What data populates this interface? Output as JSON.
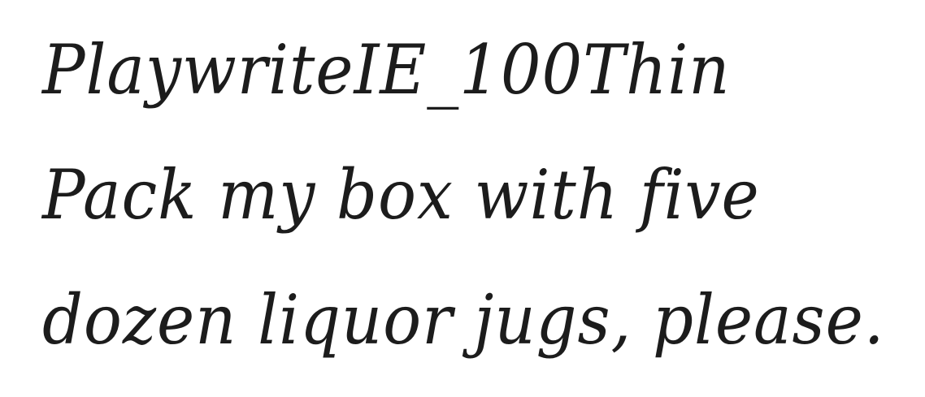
{
  "sample": {
    "font_title": "PlaywriteIE_100Thin",
    "pangram_line_1": "Pack my box with five",
    "pangram_line_2": "dozen liquor jugs, please."
  },
  "colors": {
    "background": "#ffffff",
    "text": "#1c1c1c"
  }
}
